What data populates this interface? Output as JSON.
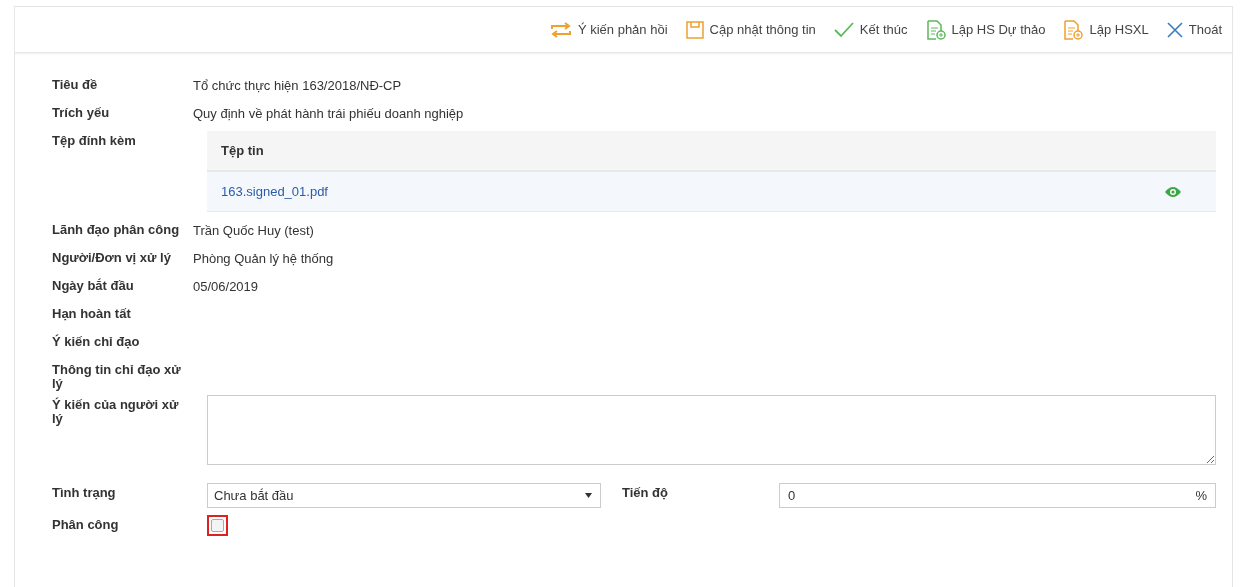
{
  "toolbar": [
    {
      "label": "Ý kiến phản hồi",
      "kind": "swap"
    },
    {
      "label": "Cập nhật thông tin",
      "kind": "save"
    },
    {
      "label": "Kết thúc",
      "kind": "check"
    },
    {
      "label": "Lập HS Dự thảo",
      "kind": "docgreen"
    },
    {
      "label": "Lập HSXL",
      "kind": "docorange"
    },
    {
      "label": "Thoát",
      "kind": "close"
    }
  ],
  "fields": [
    {
      "label": "Tiêu đề",
      "kind": "text",
      "value": "Tổ chức thực hiện 163/2018/NĐ-CP"
    },
    {
      "label": "Trích yếu",
      "kind": "text",
      "value": "Quy định về phát hành trái phiếu doanh nghiệp"
    },
    {
      "label": "Tệp đính kèm",
      "kind": "files",
      "column": "Tệp tin",
      "files": [
        "163.signed_01.pdf"
      ]
    },
    {
      "label": "Lãnh đạo phân công",
      "kind": "text",
      "value": "Trần Quốc Huy (test)"
    },
    {
      "label": "Người/Đơn vị xử lý",
      "kind": "text",
      "value": "Phòng Quản lý hệ thống"
    },
    {
      "label": "Ngày bắt đầu",
      "kind": "text",
      "value": "05/06/2019"
    },
    {
      "label": "Hạn hoàn tất",
      "kind": "text"
    },
    {
      "label": "Ý kiến chỉ đạo",
      "kind": "text"
    },
    {
      "label": "Thông tin chỉ đạo xử lý",
      "kind": "text"
    },
    {
      "label": "Ý kiến của người xử lý",
      "kind": "textarea"
    },
    {
      "label": "Tình trạng",
      "kind": "select",
      "value": "Chưa bắt đầu",
      "side_label": "Tiến độ",
      "side_value": "0",
      "side_unit": "%"
    },
    {
      "label": "Phân công",
      "kind": "checkbox",
      "checked": false
    }
  ]
}
